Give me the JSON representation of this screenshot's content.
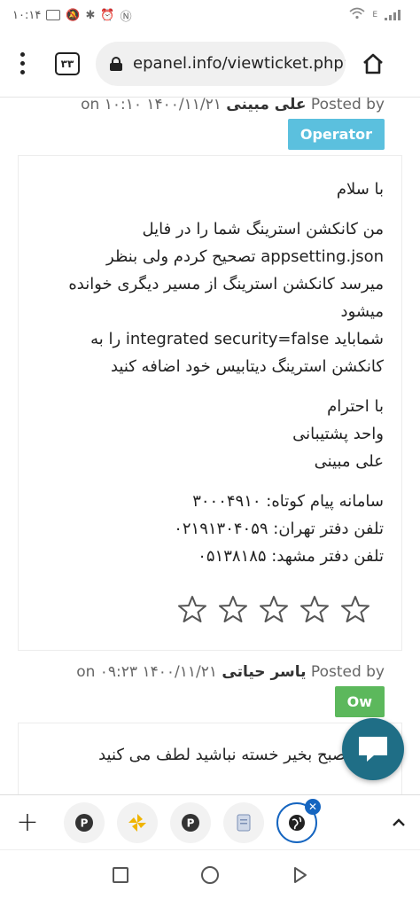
{
  "status": {
    "time": "۱۰:۱۴",
    "battery": "E"
  },
  "browser": {
    "tab_count": "۳۳",
    "url": "epanel.info/viewticket.php'"
  },
  "posts": [
    {
      "posted_by_prefix": "Posted by",
      "author": "علی مبینی",
      "datetime": "۱۴۰۰/۱۱/۲۱ ۱۰:۱۰",
      "on": "on",
      "badge": "Operator",
      "greeting": "با سلام",
      "body_lines": [
        "من کانکشن استرینگ شما را در فایل",
        "appsetting.json تصحیح کردم ولی بنظر",
        "میرسد کانکشن استرینگ از مسیر دیگری خوانده",
        "میشود",
        "شمابايد integrated security=false را به",
        "کانکشن استرینگ دیتابیس خود اضافه کنید"
      ],
      "signature": [
        "با احترام",
        "واحد پشتیبانی",
        "علی مبینی"
      ],
      "contact": [
        "سامانه پیام کوتاه: ۳۰۰۰۴۹۱۰",
        "تلفن دفتر تهران: ۰۲۱۹۱۳۰۴۰۵۹",
        "تلفن دفتر مشهد: ۰۵۱۳۸۱۸۵"
      ],
      "rating": 0
    },
    {
      "posted_by_prefix": "Posted by",
      "author": "یاسر حیاتی",
      "datetime": "۱۴۰۰/۱۱/۲۱ ۰۹:۲۳",
      "on": "on",
      "badge": "Ow",
      "first_line": "سلام صبح بخیر خسته نباشید لطف می کنید"
    }
  ],
  "tabs": {
    "add_label": "+",
    "items": [
      "pocket-icon",
      "pinwheel-icon",
      "pocket-icon",
      "document-icon",
      "globe-icon"
    ]
  },
  "colors": {
    "operator_badge": "#5bc0de",
    "owner_badge": "#5cb85c",
    "chat_fab": "#1f6e86",
    "active_tab": "#1565c0"
  }
}
